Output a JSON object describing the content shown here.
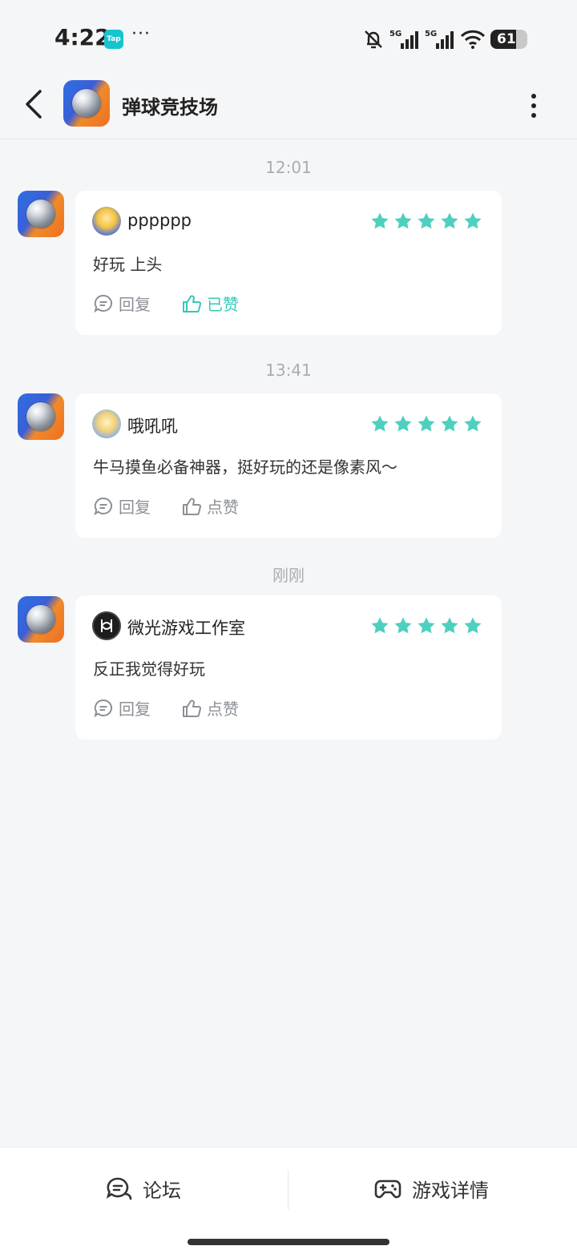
{
  "status_bar": {
    "time": "4:22",
    "tap_badge": "Tap",
    "dots": "···",
    "battery": "61"
  },
  "header": {
    "title": "弹球竞技场"
  },
  "messages": [
    {
      "time": "12:01",
      "username": "pppppp",
      "rating": 5,
      "text": "好玩 上头",
      "reply_label": "回复",
      "like_label": "已赞",
      "liked": true
    },
    {
      "time": "13:41",
      "username": "哦吼吼",
      "rating": 5,
      "text": "牛马摸鱼必备神器，挺好玩的还是像素风～",
      "reply_label": "回复",
      "like_label": "点赞",
      "liked": false
    },
    {
      "time": "刚刚",
      "username": "微光游戏工作室",
      "rating": 5,
      "text": "反正我觉得好玩",
      "reply_label": "回复",
      "like_label": "点赞",
      "liked": false
    }
  ],
  "bottom_bar": {
    "forum_label": "论坛",
    "details_label": "游戏详情"
  },
  "colors": {
    "accent": "#36c8b8",
    "star": "#4fd0bf",
    "tap": "#15c5ce"
  }
}
